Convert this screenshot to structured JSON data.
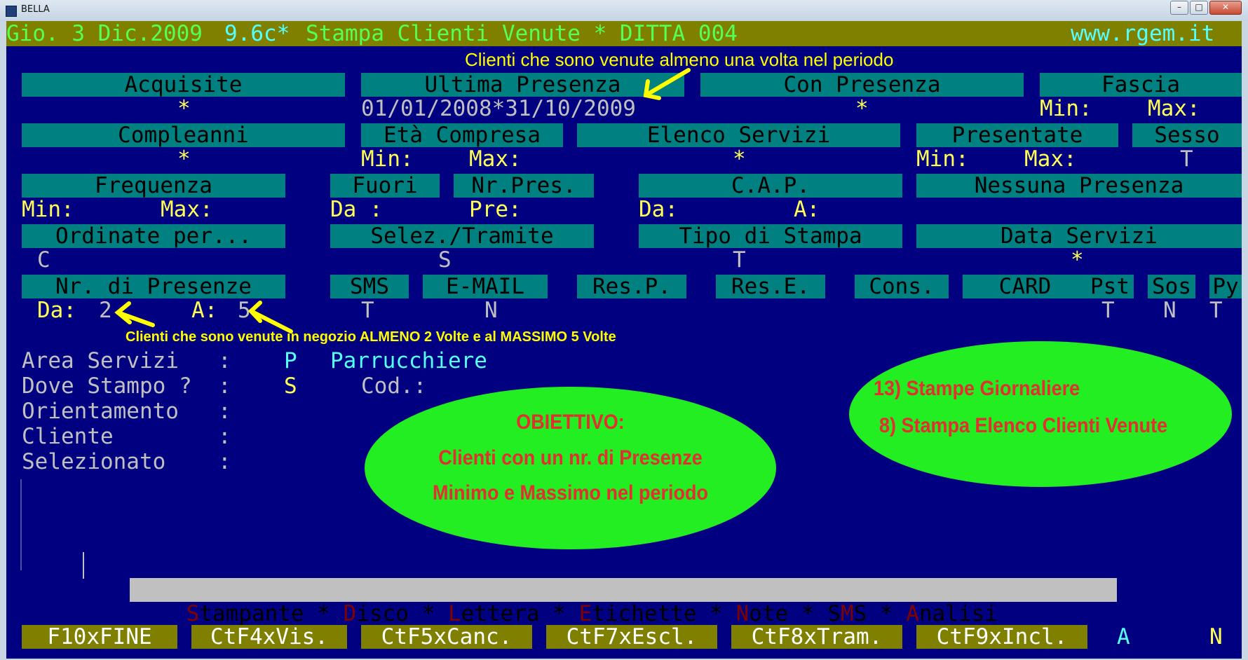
{
  "window": {
    "title": "BELLA",
    "min": "–",
    "max": "□",
    "close": "✕"
  },
  "header": {
    "date": "Gio. 3 Dic.2009",
    "version": "9.6c*",
    "title": "Stampa Clienti Venute * DITTA 004",
    "website": "www.rgem.it"
  },
  "annotations": {
    "top": "Clienti che sono venute almeno una volta nel periodo",
    "middle": "Clienti che sono venute in negozio ALMENO 2 Volte e al MASSIMO 5 Volte"
  },
  "row1": {
    "acquisite": "Acquisite",
    "ultima": "Ultima Presenza",
    "con": "Con Presenza",
    "fascia": "Fascia",
    "acquisite_val": "*",
    "period": "01/01/2008*31/10/2009",
    "con_val": "*",
    "min": "Min:",
    "max": "Max:"
  },
  "row2": {
    "compleanni": "Compleanni",
    "eta": "Età Compresa",
    "servizi": "Elenco Servizi",
    "presentate": "Presentate",
    "sesso": "Sesso",
    "compleanni_val": "*",
    "eta_min": "Min:",
    "eta_max": "Max:",
    "servizi_val": "*",
    "pres_min": "Min:",
    "pres_max": "Max:",
    "sesso_val": "T"
  },
  "row3": {
    "frequenza": "Frequenza",
    "fuori": "Fuori",
    "nrpres": "Nr.Pres.",
    "cap": "C.A.P.",
    "nessuna": "Nessuna Presenza",
    "freq_min": "Min:",
    "freq_max": "Max:",
    "fuori_da": "Da :",
    "pre": "Pre:",
    "cap_da": "Da:",
    "cap_a": "A:"
  },
  "row4": {
    "ordinate": "Ordinate per...",
    "selez": "Selez./Tramite",
    "tipo": "Tipo di Stampa",
    "dataserv": "Data Servizi",
    "ordinate_val": "C",
    "selez_val": "S",
    "tipo_val": "T",
    "dataserv_val": "*"
  },
  "row5": {
    "nrpresenze": "Nr. di Presenze",
    "sms": "SMS",
    "email": "E-MAIL",
    "resp": "Res.P.",
    "rese": "Res.E.",
    "cons": "Cons.",
    "card": "CARD",
    "pst": "Pst",
    "sos": "Sos",
    "py": "Py",
    "da_label": "Da:",
    "da_val": "2",
    "a_label": "A:",
    "a_val": "5",
    "sms_val": "T",
    "email_val": "N",
    "pst_val": "T",
    "sos_val": "N",
    "py_val": "T"
  },
  "info": {
    "area_label": "Area Servizi   :",
    "area_code": "P",
    "area_name": "Parrucchiere",
    "dove_label": "Dove Stampo ?  :",
    "dove_val": "S",
    "cod_label": "Cod.:",
    "orient_label": "Orientamento   :",
    "cliente_label": "Cliente        :",
    "selez_label": "Selezionato    :"
  },
  "callouts": {
    "obiettivo_title": "OBIETTIVO:",
    "obiettivo_line1": "Clienti con un nr. di Presenze",
    "obiettivo_line2": "Minimo e Massimo nel periodo",
    "menu_line1": "13) Stampe Giornaliere",
    "menu_line2": "8) Stampa Elenco Clienti Venute"
  },
  "menubar": [
    {
      "hot": "S",
      "rest": "tampante"
    },
    {
      "hot": "D",
      "rest": "isco"
    },
    {
      "hot": "L",
      "rest": "ettera"
    },
    {
      "hot": "E",
      "rest": "tichette"
    },
    {
      "hot": "N",
      "rest": "ote"
    },
    {
      "plain": "S",
      "hot": "M",
      "rest": "S"
    },
    {
      "hot": "A",
      "rest": "nalisi"
    }
  ],
  "fkeys": [
    "F10xFINE",
    "CtF4xVis.",
    "CtF5xCanc.",
    "CtF7xEscl.",
    "CtF8xTram.",
    "CtF9xIncl."
  ],
  "status": {
    "left": "A",
    "right": "N"
  },
  "colors": {
    "background": "#000080",
    "header": "#808000",
    "label": "#008080",
    "value": "#ffff55",
    "annotation": "#ffff00",
    "ellipse": "#22ee22",
    "ellipse_text": "#e03030"
  }
}
